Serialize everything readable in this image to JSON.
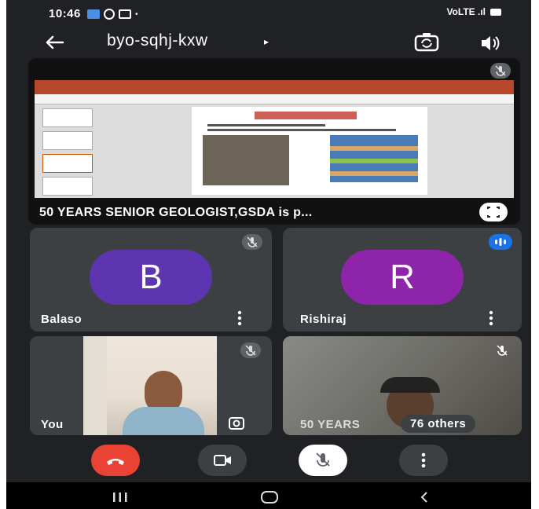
{
  "status_bar": {
    "time": "10:46",
    "signal_text": "VoLTE .ıl"
  },
  "toolbar": {
    "meeting_code": "byo-sqhj-kxw",
    "caret": "▸"
  },
  "presentation": {
    "caption": "50 YEARS SENIOR GEOLOGIST,GSDA is p..."
  },
  "participants": [
    {
      "initial": "B",
      "name": "Balaso",
      "avatar_color": "#5e35b1",
      "mic": "muted"
    },
    {
      "initial": "R",
      "name": "Rishiraj",
      "avatar_color": "#8e24aa",
      "mic": "speaking"
    }
  ],
  "self_tile": {
    "name": "You"
  },
  "others_tile": {
    "name_partial": "50 YEARS",
    "others_label": "76 others"
  },
  "colors": {
    "end_call": "#ea4335",
    "speaking": "#1a73e8",
    "tile_bg": "#3c4043",
    "screen_bg": "#202124"
  }
}
